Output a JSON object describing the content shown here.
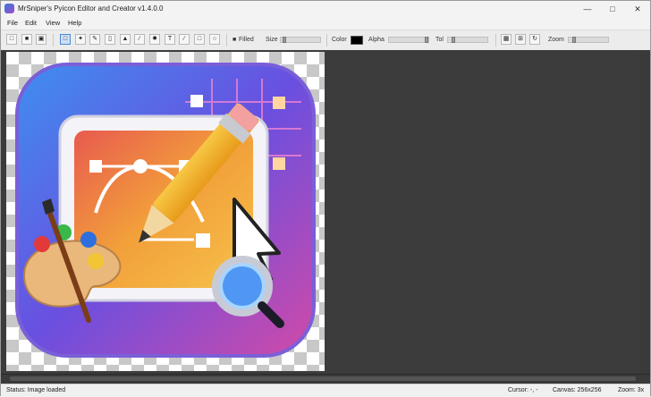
{
  "window": {
    "title": "MrSniper's Pyicon Editor and Creator v1.4.0.0"
  },
  "menu": {
    "file": "File",
    "edit": "Edit",
    "view": "View",
    "help": "Help"
  },
  "toolbar": {
    "size_label": "Size",
    "color_label": "Color",
    "alpha_label": "Alpha",
    "tol_label": "Tol",
    "zoom_label": "Zoom",
    "filled_label": "Filled",
    "current_color": "#000000"
  },
  "status": {
    "message": "Status: Image loaded",
    "cursor": "Cursor: -, -",
    "canvas": "Canvas: 256x256",
    "zoom": "Zoom: 3x"
  },
  "icons": {
    "new": "new-icon",
    "open": "open-icon",
    "save": "save-icon",
    "select": "select-icon",
    "move": "move-icon",
    "pencil": "pencil-icon",
    "eraser": "eraser-icon",
    "fill": "fill-icon",
    "picker": "picker-icon",
    "wand": "wand-icon",
    "text": "text-icon",
    "line": "line-icon",
    "rect": "rect-icon",
    "ellipse": "ellipse-icon",
    "grid": "grid-icon",
    "crop": "crop-icon",
    "rotate": "rotate-icon"
  }
}
